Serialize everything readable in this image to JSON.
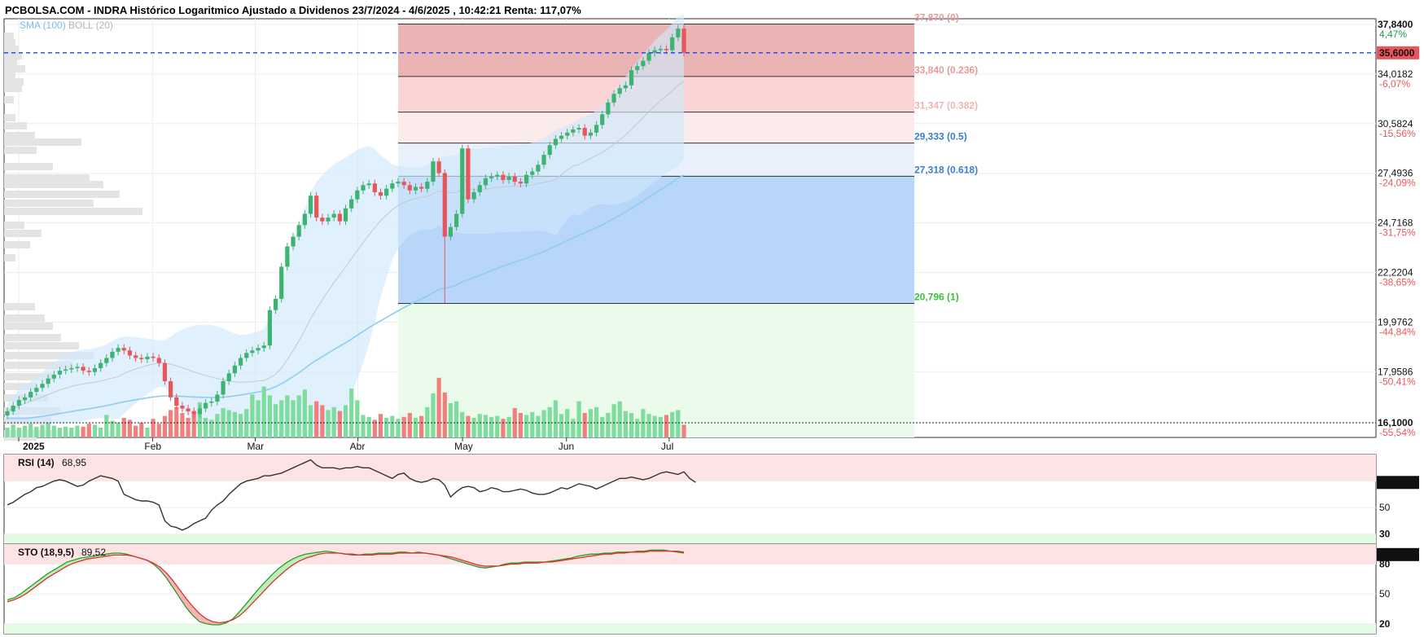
{
  "title": "PCBOLSA.COM - INDRA Histórico Logaritmico Ajustado a Dividenos 23/7/2024 - 4/6/2025 , 10:42:21 Renta: 117,07%",
  "legend": {
    "sma": "SMA (100)",
    "boll": "BOLL (20)"
  },
  "colors": {
    "up": "#3cb371",
    "down": "#e8555a",
    "up_vol": "#7ddc9e",
    "down_vol": "#f08080",
    "boll_fill": "#cfe8fb",
    "sma": "#8ecdf3",
    "current": "#1e3ff0",
    "fib_red": "#e8a3a6",
    "fib_pink": "#fcd9d9",
    "fib_blue": "#b7d4fb",
    "fib_green": "#e6fae6"
  },
  "chart_data": [
    {
      "type": "candlestick",
      "title": "PCBOLSA.COM - INDRA Histórico Logaritmico Ajustado a Dividenos 23/7/2024 - 4/6/2025 , 10:42:21 Renta: 117,07%",
      "x_labels": [
        "2025",
        "Feb",
        "Mar",
        "Abr",
        "May",
        "Jun",
        "Jul"
      ],
      "y_ticks": [
        "37,8400",
        "34,0182",
        "30,5824",
        "27,4936",
        "24,7168",
        "22,2204",
        "19,9762",
        "17,9586",
        "16,1000"
      ],
      "y_pct_ticks": [
        "4,47%",
        "-6,07%",
        "-15,56%",
        "-24,09%",
        "-31,75%",
        "-38,65%",
        "-44,84%",
        "-50,41%",
        "-55,54%"
      ],
      "ylim": [
        15.6,
        38.3
      ],
      "scale": "log",
      "current_price": "35,6000",
      "close_series": [
        16.5,
        16.7,
        16.9,
        17.0,
        17.2,
        17.35,
        17.5,
        17.7,
        17.85,
        18.0,
        18.05,
        18.1,
        18.15,
        18.0,
        17.95,
        18.1,
        18.3,
        18.5,
        18.75,
        18.9,
        18.8,
        18.6,
        18.5,
        18.45,
        18.55,
        18.5,
        18.3,
        17.6,
        17.0,
        16.7,
        16.6,
        16.5,
        16.4,
        16.6,
        16.8,
        16.85,
        17.1,
        17.6,
        17.9,
        18.2,
        18.5,
        18.7,
        18.8,
        18.9,
        19.0,
        20.5,
        21.0,
        22.5,
        23.5,
        24.0,
        24.6,
        25.2,
        26.2,
        25.0,
        24.8,
        25.0,
        25.2,
        24.8,
        25.5,
        26.0,
        26.5,
        26.8,
        26.9,
        26.4,
        26.2,
        26.6,
        26.9,
        27.0,
        26.8,
        26.5,
        26.7,
        26.6,
        27.0,
        28.2,
        27.5,
        24.0,
        24.5,
        25.2,
        29.0,
        26.0,
        26.4,
        26.8,
        27.2,
        27.3,
        27.4,
        27.1,
        27.3,
        27.0,
        26.9,
        27.4,
        27.6,
        28.0,
        28.6,
        29.2,
        29.6,
        29.8,
        30.0,
        30.2,
        30.3,
        29.8,
        30.0,
        30.5,
        31.2,
        32.0,
        32.6,
        33.0,
        33.2,
        34.3,
        34.6,
        35.0,
        35.6,
        35.8,
        35.9,
        35.8,
        36.8,
        37.5,
        35.6
      ],
      "volume_series": [
        1.0,
        1.3,
        1.0,
        1.2,
        1.4,
        1.1,
        1.3,
        1.5,
        1.2,
        1.0,
        1.1,
        1.0,
        1.2,
        1.1,
        1.4,
        1.3,
        1.0,
        2.3,
        1.7,
        1.5,
        2.0,
        1.8,
        1.2,
        1.5,
        1.0,
        1.9,
        1.4,
        2.2,
        2.8,
        3.1,
        2.5,
        2.0,
        2.7,
        3.6,
        2.0,
        1.8,
        2.4,
        3.0,
        2.8,
        2.6,
        2.4,
        2.9,
        4.4,
        3.8,
        5.2,
        4.3,
        3.4,
        3.8,
        4.3,
        3.8,
        4.3,
        4.9,
        3.3,
        3.7,
        3.3,
        2.8,
        3.1,
        2.7,
        3.3,
        5.0,
        3.8,
        2.3,
        2.1,
        1.8,
        2.4,
        2.0,
        2.2,
        1.9,
        2.1,
        2.5,
        2.0,
        2.2,
        3.1,
        4.5,
        6.1,
        4.6,
        3.5,
        3.7,
        2.6,
        2.2,
        2.0,
        2.4,
        2.3,
        2.1,
        2.2,
        1.9,
        2.1,
        3.0,
        2.5,
        2.3,
        2.6,
        2.2,
        2.8,
        3.1,
        3.8,
        2.4,
        2.9,
        1.9,
        3.7,
        2.5,
        2.9,
        3.1,
        2.1,
        2.5,
        3.4,
        3.7,
        2.7,
        2.5,
        1.9,
        2.9,
        2.4,
        2.2,
        2.1,
        2.3,
        2.6,
        2.8,
        1.3
      ]
    },
    {
      "type": "fibonacci",
      "levels": [
        {
          "value": 37.87,
          "label": "37,870 (0)"
        },
        {
          "value": 33.84,
          "label": "33,840 (0.236)"
        },
        {
          "value": 31.347,
          "label": "31,347 (0.382)"
        },
        {
          "value": 29.333,
          "label": "29,333 (0.5)"
        },
        {
          "value": 27.318,
          "label": "27,318 (0.618)"
        },
        {
          "value": 20.796,
          "label": "20,796 (1)"
        }
      ]
    },
    {
      "type": "line",
      "name": "RSI (14)",
      "label_value": "68,95",
      "current": "68,950",
      "y_ticks": [
        "70",
        "50",
        "30"
      ],
      "values": [
        52,
        54,
        57,
        60,
        62,
        65,
        66,
        68,
        70,
        71,
        70,
        68,
        66,
        67,
        70,
        72,
        74,
        73,
        72,
        70,
        60,
        58,
        56,
        55,
        55,
        54,
        52,
        40,
        36,
        35,
        33,
        35,
        38,
        40,
        42,
        48,
        52,
        55,
        60,
        64,
        68,
        70,
        71,
        72,
        74,
        74,
        75,
        76,
        78,
        80,
        82,
        84,
        86,
        82,
        80,
        80,
        80,
        79,
        80,
        80,
        81,
        80,
        80,
        78,
        76,
        74,
        72,
        75,
        76,
        72,
        70,
        69,
        70,
        72,
        71,
        67,
        58,
        62,
        65,
        66,
        65,
        62,
        63,
        65,
        64,
        62,
        62,
        63,
        64,
        63,
        61,
        60,
        60,
        61,
        63,
        65,
        64,
        66,
        68,
        67,
        66,
        64,
        66,
        68,
        70,
        72,
        72,
        73,
        72,
        71,
        72,
        74,
        76,
        77,
        76,
        75,
        77,
        72,
        69
      ]
    },
    {
      "type": "line",
      "name": "STO (18,9,5)",
      "label_value": "89,52",
      "current": "89,521",
      "y_ticks": [
        "80",
        "50",
        "20"
      ],
      "k": [
        44,
        46,
        50,
        55,
        60,
        65,
        70,
        74,
        78,
        82,
        84,
        86,
        87,
        88,
        89,
        90,
        91,
        91,
        90,
        88,
        86,
        84,
        80,
        74,
        66,
        56,
        46,
        36,
        28,
        22,
        20,
        19,
        19,
        21,
        25,
        32,
        40,
        48,
        56,
        63,
        70,
        76,
        81,
        85,
        88,
        90,
        91,
        92,
        93,
        92,
        91,
        90,
        89,
        89,
        90,
        90,
        91,
        91,
        91,
        92,
        92,
        91,
        92,
        91,
        90,
        89,
        87,
        85,
        83,
        81,
        79,
        77,
        76,
        77,
        78,
        80,
        81,
        81,
        82,
        82,
        82,
        82,
        83,
        84,
        85,
        86,
        88,
        89,
        90,
        90,
        91,
        91,
        92,
        92,
        92,
        93,
        93,
        94,
        94,
        94,
        93,
        92,
        91
      ],
      "d": [
        42,
        44,
        47,
        51,
        56,
        61,
        66,
        70,
        74,
        78,
        81,
        83,
        85,
        86,
        87,
        88,
        89,
        89,
        89,
        88,
        86,
        84,
        81,
        77,
        71,
        63,
        54,
        45,
        37,
        30,
        25,
        22,
        21,
        22,
        24,
        28,
        34,
        41,
        48,
        55,
        62,
        68,
        74,
        79,
        83,
        86,
        88,
        90,
        91,
        91,
        91,
        90,
        90,
        89,
        89,
        89,
        90,
        90,
        90,
        91,
        91,
        91,
        91,
        91,
        90,
        89,
        88,
        87,
        85,
        83,
        81,
        79,
        78,
        78,
        78,
        79,
        80,
        80,
        81,
        81,
        81,
        82,
        82,
        83,
        84,
        85,
        86,
        87,
        88,
        89,
        90,
        90,
        91,
        91,
        92,
        92,
        92,
        93,
        93,
        93,
        93,
        93,
        92
      ]
    }
  ]
}
